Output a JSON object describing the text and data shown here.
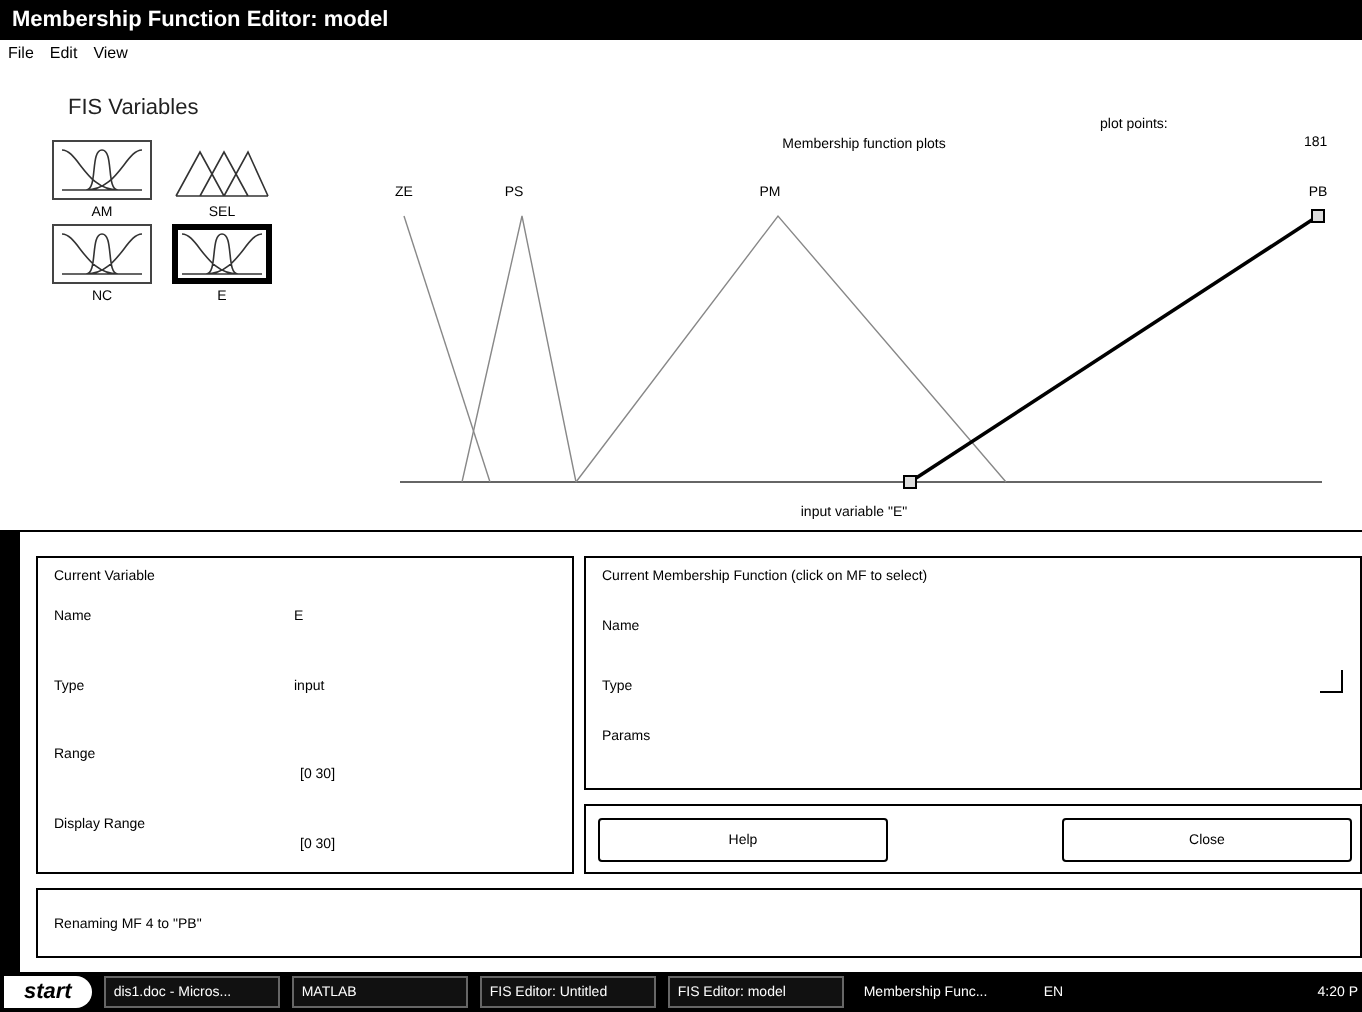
{
  "window": {
    "title": "Membership Function Editor: model"
  },
  "menu": [
    "File",
    "Edit",
    "View"
  ],
  "fis_variables": {
    "title": "FIS Variables",
    "items": [
      {
        "label": "AM",
        "kind": "input",
        "selected": false
      },
      {
        "label": "SEL",
        "kind": "output",
        "selected": false
      },
      {
        "label": "NC",
        "kind": "input",
        "selected": false
      },
      {
        "label": "E",
        "kind": "input",
        "selected": true
      }
    ]
  },
  "plot": {
    "title": "Membership function plots",
    "plot_points_label": "plot points:",
    "plot_points": "181",
    "xlabel": "input variable \"E\"",
    "mfs": [
      {
        "label": "ZE",
        "selected": false
      },
      {
        "label": "PS",
        "selected": false
      },
      {
        "label": "PM",
        "selected": false
      },
      {
        "label": "PB",
        "selected": true
      }
    ]
  },
  "current_variable": {
    "title": "Current Variable",
    "fields": [
      {
        "label": "Name",
        "value": "E"
      },
      {
        "label": "Type",
        "value": "input"
      },
      {
        "label": "Range",
        "value": "[0 30]"
      },
      {
        "label": "Display Range",
        "value": "[0 30]"
      }
    ]
  },
  "current_mf": {
    "title": "Current Membership Function (click on MF to select)",
    "fields": [
      "Name",
      "Type",
      "Params"
    ]
  },
  "buttons": [
    "Help",
    "Close"
  ],
  "status": "Renaming MF 4 to \"PB\"",
  "taskbar": {
    "start": "start",
    "items": [
      {
        "label": "dis1.doc - Micros...",
        "selected": false
      },
      {
        "label": "MATLAB",
        "selected": false
      },
      {
        "label": "FIS Editor: Untitled",
        "selected": false
      },
      {
        "label": "FIS Editor: model",
        "selected": false
      },
      {
        "label": "Membership Func...",
        "selected": true
      }
    ],
    "language": "EN",
    "clock": "4:20 P"
  }
}
